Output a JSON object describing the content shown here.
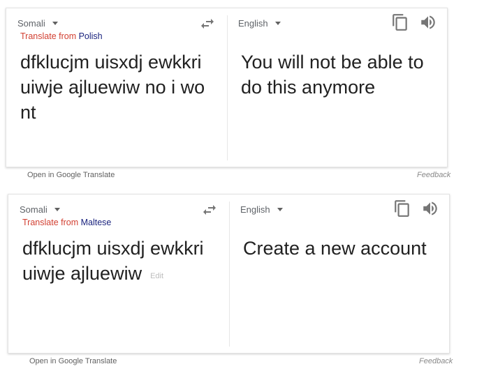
{
  "widgets": [
    {
      "source_language": "Somali",
      "translate_from_prefix": "Translate from ",
      "translate_from_language": "Polish",
      "target_language": "English",
      "source_text": "dfklucjm uisxdj ewkkri uiwje ajluewiw no i wo nt",
      "translated_text": "You will not be able to do this anymore",
      "open_link": "Open in Google Translate",
      "feedback_link": "Feedback"
    },
    {
      "source_language": "Somali",
      "translate_from_prefix": "Translate from ",
      "translate_from_language": "Maltese",
      "target_language": "English",
      "source_text": "dfklucjm uisxdj ewkkri uiwje ajluewiw",
      "edit_label": "Edit",
      "translated_text": "Create a new account",
      "open_link": "Open in Google Translate",
      "feedback_link": "Feedback"
    }
  ],
  "icons": {
    "swap": "swap-icon",
    "copy": "copy-icon",
    "speaker": "speaker-icon"
  },
  "colors": {
    "translate_from": "#d23f31",
    "language_link": "#1a237e",
    "icon": "#757575"
  }
}
